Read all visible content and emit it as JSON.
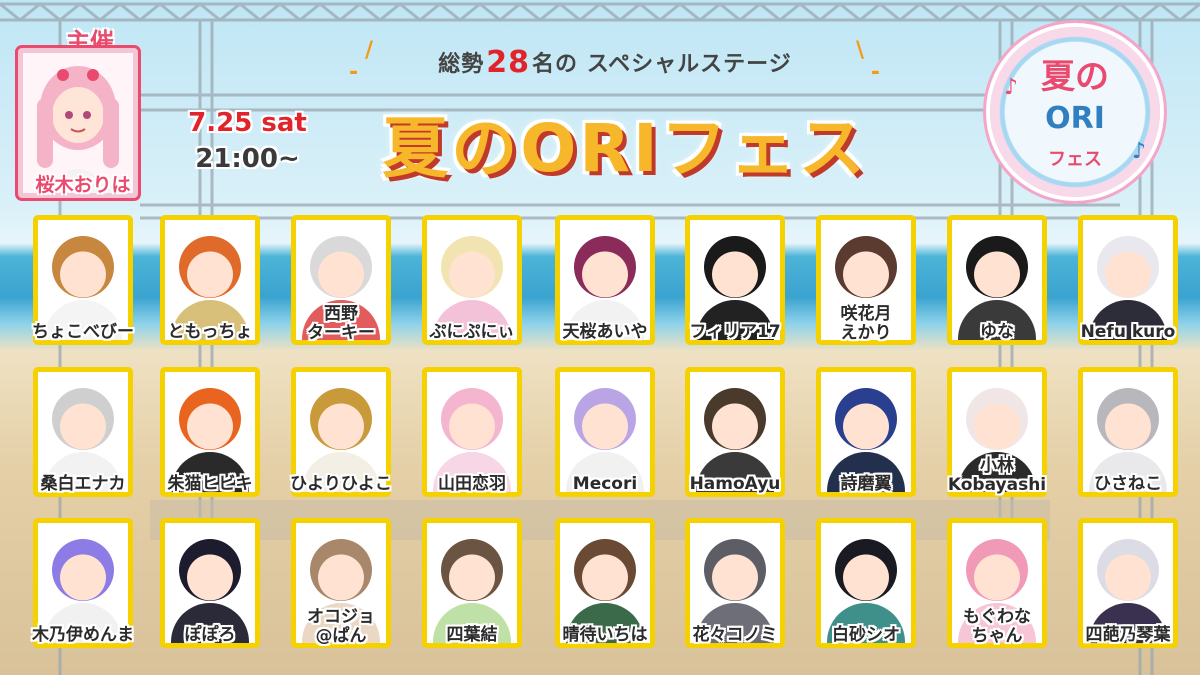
{
  "event": {
    "subtitle_prefix": "総勢",
    "subtitle_number": "28",
    "subtitle_suffix": "名の スペシャルステージ",
    "date": "7.25 sat",
    "time": "21:00~",
    "title": "夏のORIフェス"
  },
  "host": {
    "label": "主催",
    "name": "桜木おりは"
  },
  "logo": {
    "line1": "夏の",
    "line2": "ORI",
    "line3": "フェス"
  },
  "colors": {
    "card_border": "#f5d100",
    "title_fill": "#f6b72a",
    "accent_red": "#e1242a",
    "host_pink": "#e94a6e"
  },
  "performers": [
    {
      "name": "ちょこべびー",
      "hair": "#c8873e",
      "cloth": "#f4f4f4"
    },
    {
      "name": "ともっちょ",
      "hair": "#e06a2a",
      "cloth": "#d9c07a"
    },
    {
      "name": "西野\nターキー",
      "hair": "#d9d9d9",
      "cloth": "#e25c5c"
    },
    {
      "name": "ぷにぷにぃ",
      "hair": "#f1e4b0",
      "cloth": "#f3c2d8"
    },
    {
      "name": "天桜あいや",
      "hair": "#8a2b5a",
      "cloth": "#f2f2f2"
    },
    {
      "name": "フィリア17",
      "hair": "#1a1a1a",
      "cloth": "#222222"
    },
    {
      "name": "咲花月\nえかり",
      "hair": "#5b3b2f",
      "cloth": "#ffffff"
    },
    {
      "name": "ゆな",
      "hair": "#1a1a1a",
      "cloth": "#3a3a3a"
    },
    {
      "name": "Nefu kuro",
      "hair": "#e8e8ee",
      "cloth": "#2d2d3a"
    },
    {
      "name": "桑白エナカ",
      "hair": "#cfcfcf",
      "cloth": "#f2f2f2"
    },
    {
      "name": "朱猫ヒビキ",
      "hair": "#e8641f",
      "cloth": "#2a2a2a"
    },
    {
      "name": "ひよりひよこ",
      "hair": "#c89a3a",
      "cloth": "#f3efe4"
    },
    {
      "name": "山田恋羽",
      "hair": "#f4b6cf",
      "cloth": "#f7d6e6"
    },
    {
      "name": "Mecori",
      "hair": "#b9a4e6",
      "cloth": "#f1f1f1"
    },
    {
      "name": "HamoAyu",
      "hair": "#4a3a2c",
      "cloth": "#3a3a3a"
    },
    {
      "name": "詩磨翼",
      "hair": "#2a3f8f",
      "cloth": "#22304e"
    },
    {
      "name": "小林\nKobayashi",
      "hair": "#f1e6e6",
      "cloth": "#2a2a2a"
    },
    {
      "name": "ひさねこ",
      "hair": "#b8b8bc",
      "cloth": "#e9e9ec"
    },
    {
      "name": "木乃伊めんま",
      "hair": "#8d7be6",
      "cloth": "#f1f1f1"
    },
    {
      "name": "ぽぽろ",
      "hair": "#1c1c2e",
      "cloth": "#2a2a38"
    },
    {
      "name": "オコジョ\n@ぱん",
      "hair": "#a8876a",
      "cloth": "#ead8c4"
    },
    {
      "name": "四葉結",
      "hair": "#6b5442",
      "cloth": "#bfe0a6"
    },
    {
      "name": "晴待いちは",
      "hair": "#6a4a34",
      "cloth": "#3b6a4a"
    },
    {
      "name": "花々コノミ",
      "hair": "#5d5d66",
      "cloth": "#6e6e78"
    },
    {
      "name": "白砂シオ",
      "hair": "#1a1a22",
      "cloth": "#3f8f8a"
    },
    {
      "name": "もぐわな\nちゃん",
      "hair": "#f19ab8",
      "cloth": "#f7c6d6"
    },
    {
      "name": "四葩乃琴葉",
      "hair": "#dcdce6",
      "cloth": "#3a3050"
    }
  ]
}
